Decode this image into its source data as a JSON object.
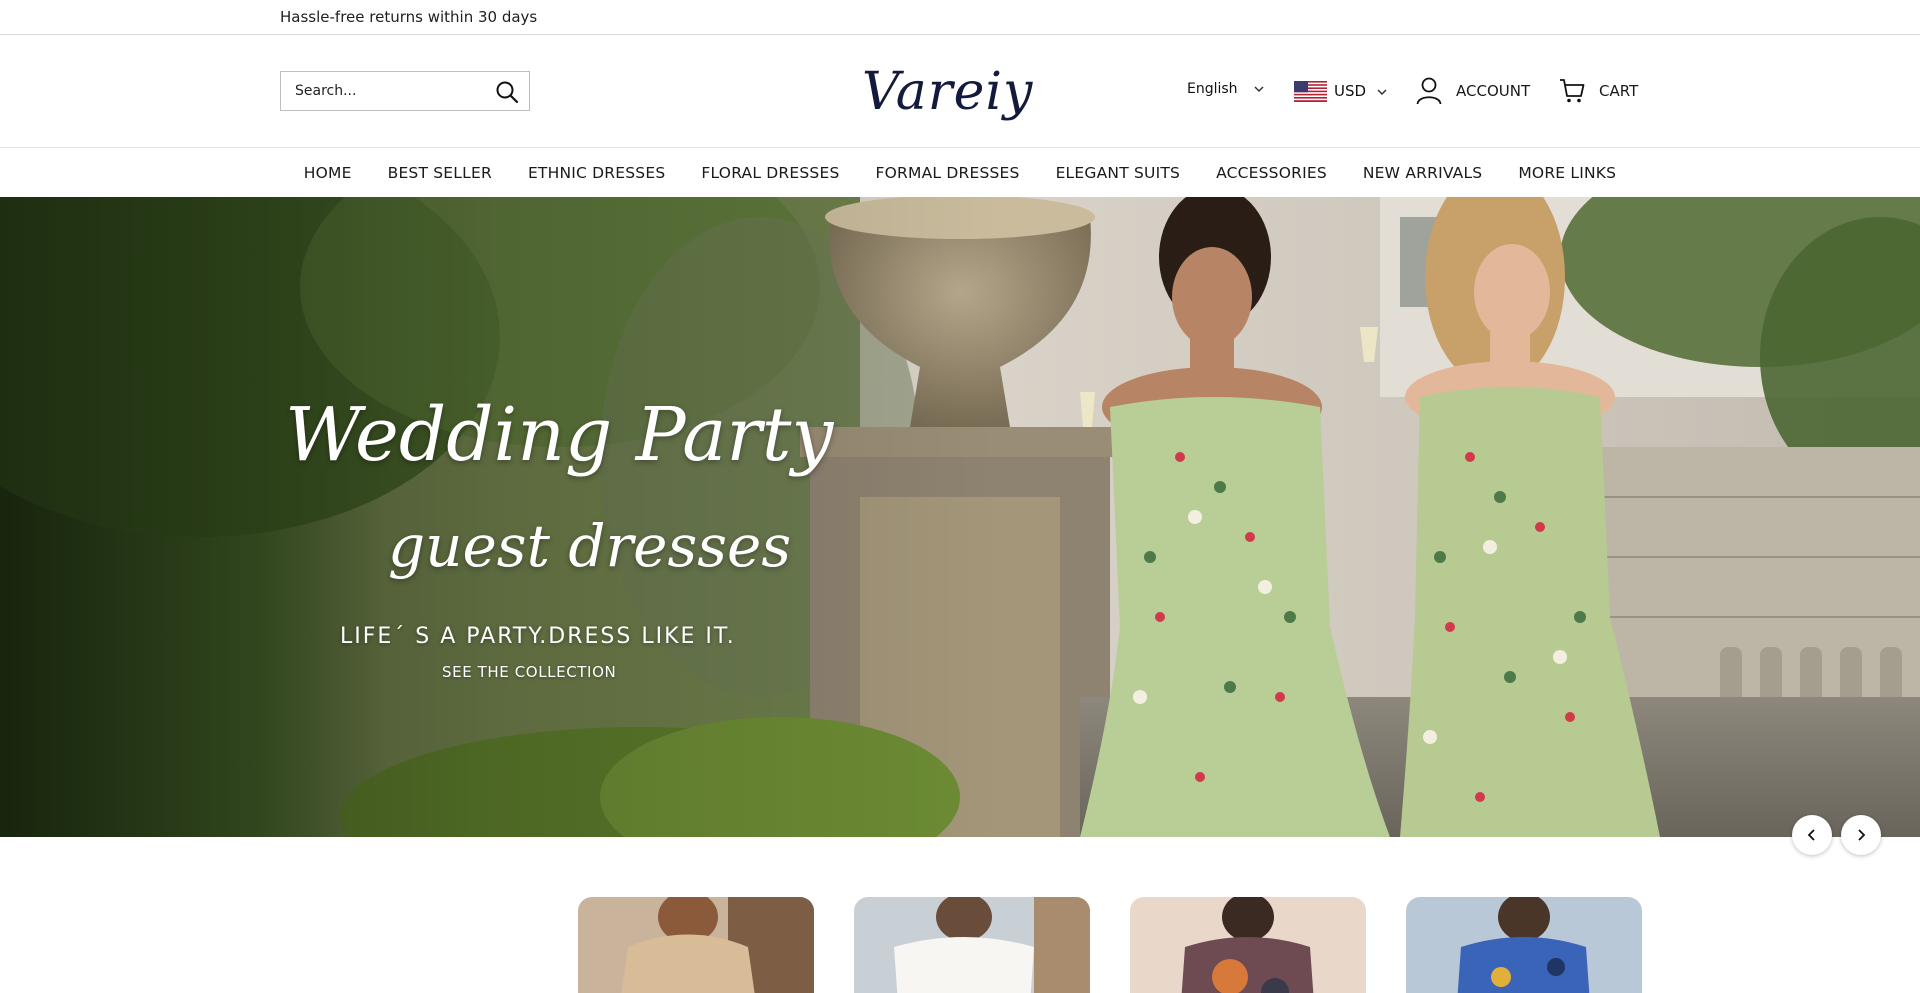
{
  "announcement": {
    "text": "Hassle-free returns within 30 days"
  },
  "header": {
    "search": {
      "placeholder": "Search...",
      "icon": "search-icon"
    },
    "logo": "Vareiy",
    "language": {
      "selected": "English"
    },
    "currency": {
      "selected": "USD",
      "flag_icon": "us-flag-icon"
    },
    "account_label": "ACCOUNT",
    "cart_label": "CART"
  },
  "nav": {
    "items": [
      {
        "label": "HOME"
      },
      {
        "label": "BEST SELLER"
      },
      {
        "label": "ETHNIC DRESSES"
      },
      {
        "label": "FLORAL DRESSES"
      },
      {
        "label": "FORMAL DRESSES"
      },
      {
        "label": "ELEGANT SUITS"
      },
      {
        "label": "ACCESSORIES"
      },
      {
        "label": "NEW ARRIVALS"
      },
      {
        "label": "MORE LINKS"
      }
    ]
  },
  "hero": {
    "title": "Wedding Party",
    "subtitle": "guest dresses",
    "tagline": "LIFE´ S A PARTY.DRESS LIKE IT.",
    "cta": "SEE THE COLLECTION"
  },
  "carousel": {
    "prev_icon": "chevron-left-icon",
    "next_icon": "chevron-right-icon"
  },
  "colors": {
    "logo": "#141a3c",
    "hero_foliage": "#3f5a26",
    "dress_green": "#b9cd96"
  }
}
